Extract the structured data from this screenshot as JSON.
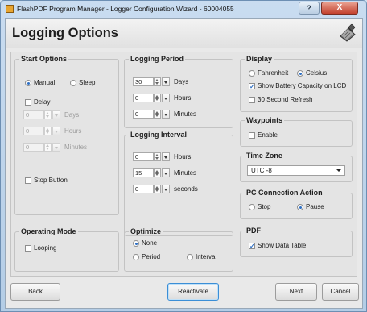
{
  "window": {
    "title": "FlashPDF Program Manager - Logger Configuration Wizard - 60004055",
    "help_glyph": "?",
    "close_glyph": "X"
  },
  "page_title": "Logging Options",
  "start_options": {
    "title": "Start Options",
    "manual_label": "Manual",
    "sleep_label": "Sleep",
    "delay_label": "Delay",
    "delay_days_value": "0",
    "delay_days_unit": "Days",
    "delay_hours_value": "0",
    "delay_hours_unit": "Hours",
    "delay_minutes_value": "0",
    "delay_minutes_unit": "Minutes",
    "stop_button_label": "Stop Button"
  },
  "logging_period": {
    "title": "Logging Period",
    "days_value": "30",
    "days_unit": "Days",
    "hours_value": "0",
    "hours_unit": "Hours",
    "minutes_value": "0",
    "minutes_unit": "Minutes"
  },
  "logging_interval": {
    "title": "Logging Interval",
    "hours_value": "0",
    "hours_unit": "Hours",
    "minutes_value": "15",
    "minutes_unit": "Minutes",
    "seconds_value": "0",
    "seconds_unit": "seconds"
  },
  "display": {
    "title": "Display",
    "fahrenheit_label": "Fahrenheit",
    "celsius_label": "Celsius",
    "battery_label": "Show Battery Capacity on LCD",
    "refresh_label": "30 Second Refresh"
  },
  "waypoints": {
    "title": "Waypoints",
    "enable_label": "Enable"
  },
  "time_zone": {
    "title": "Time Zone",
    "value": "UTC -8"
  },
  "pc_connection": {
    "title": "PC Connection Action",
    "stop_label": "Stop",
    "pause_label": "Pause"
  },
  "operating_mode": {
    "title": "Operating Mode",
    "looping_label": "Looping"
  },
  "optimize": {
    "title": "Optimize",
    "none_label": "None",
    "period_label": "Period",
    "interval_label": "Interval"
  },
  "pdf": {
    "title": "PDF",
    "data_table_label": "Show Data Table"
  },
  "footer": {
    "back_label": "Back",
    "reactivate_label": "Reactivate",
    "next_label": "Next",
    "cancel_label": "Cancel"
  },
  "check_glyph": "✓",
  "colors": {
    "accent": "#2d6fc4",
    "window_frame": "#b4cde6",
    "close_button": "#c3412d"
  }
}
